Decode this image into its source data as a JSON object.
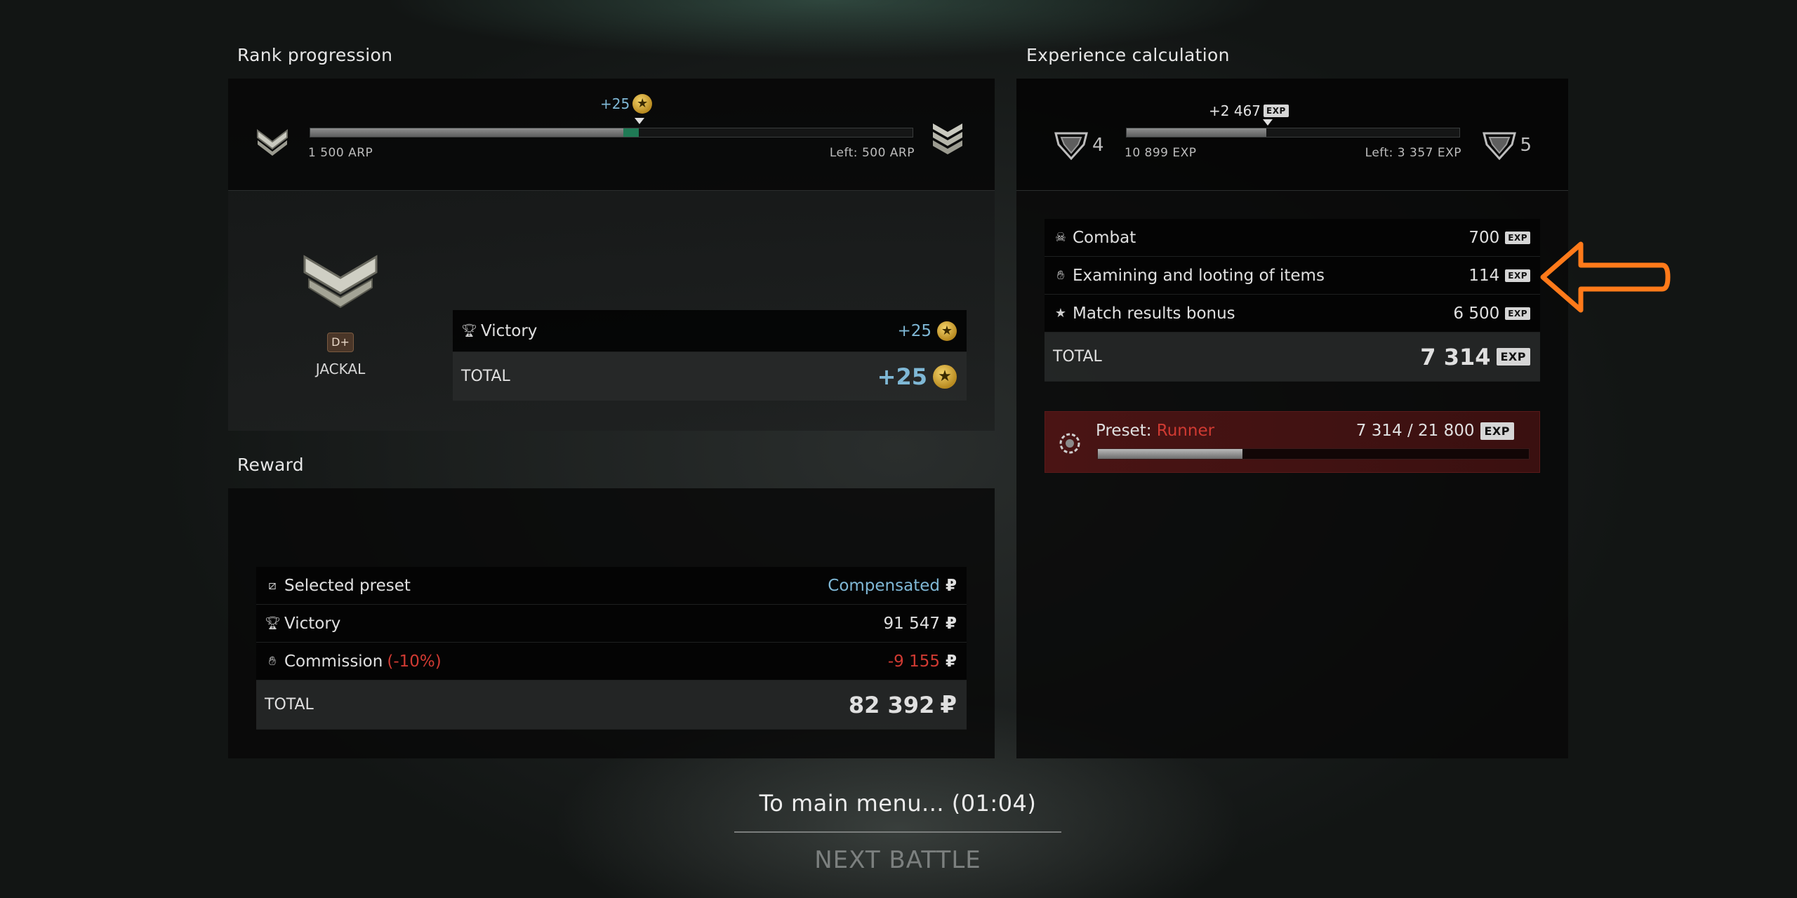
{
  "rank": {
    "title": "Rank progression",
    "gain_label": "+25",
    "start_label": "1 500 ARP",
    "left_label": "Left: 500 ARP",
    "progress_fraction": 0.52,
    "gain_fraction": 0.025,
    "rank_name": "JACKAL",
    "rank_badge": "D+",
    "rows": [
      {
        "label": "Victory",
        "value": "+25",
        "icon": "trophy-icon"
      }
    ],
    "total_label": "TOTAL",
    "total_value": "+25"
  },
  "experience": {
    "title": "Experience calculation",
    "gain_label": "+2 467",
    "start_label": "10 899 EXP",
    "left_label": "Left: 3 357 EXP",
    "level_current": "4",
    "level_next": "5",
    "progress_fraction": 0.42,
    "exp_badge": "EXP",
    "rows": [
      {
        "label": "Combat",
        "value": "700",
        "icon": "skull-icon"
      },
      {
        "label": "Examining and looting of items",
        "value": "114",
        "icon": "hand-icon"
      },
      {
        "label": "Match results bonus",
        "value": "6 500",
        "icon": "star-icon"
      }
    ],
    "total_label": "TOTAL",
    "total_value": "7 314",
    "preset": {
      "label": "Preset:",
      "name": "Runner",
      "value": "7 314 / 21 800",
      "progress_fraction": 0.335
    }
  },
  "reward": {
    "title": "Reward",
    "rows": [
      {
        "label": "Selected preset",
        "value": "Compensated",
        "icon": "preset-icon"
      },
      {
        "label": "Victory",
        "value": "91 547",
        "icon": "trophy-icon"
      },
      {
        "label": "Commission",
        "label_extra": "(-10%)",
        "value": "-9 155",
        "icon": "hand-icon"
      }
    ],
    "currency": "₽",
    "total_label": "TOTAL",
    "total_value": "82 392"
  },
  "footer": {
    "main_menu": "To main menu... (01:04)",
    "next_battle": "NEXT BATTLE"
  },
  "colors": {
    "accent_blue": "#7fb8d6",
    "warning_red": "#d03a32",
    "annotation_orange": "#ff7a1a"
  }
}
